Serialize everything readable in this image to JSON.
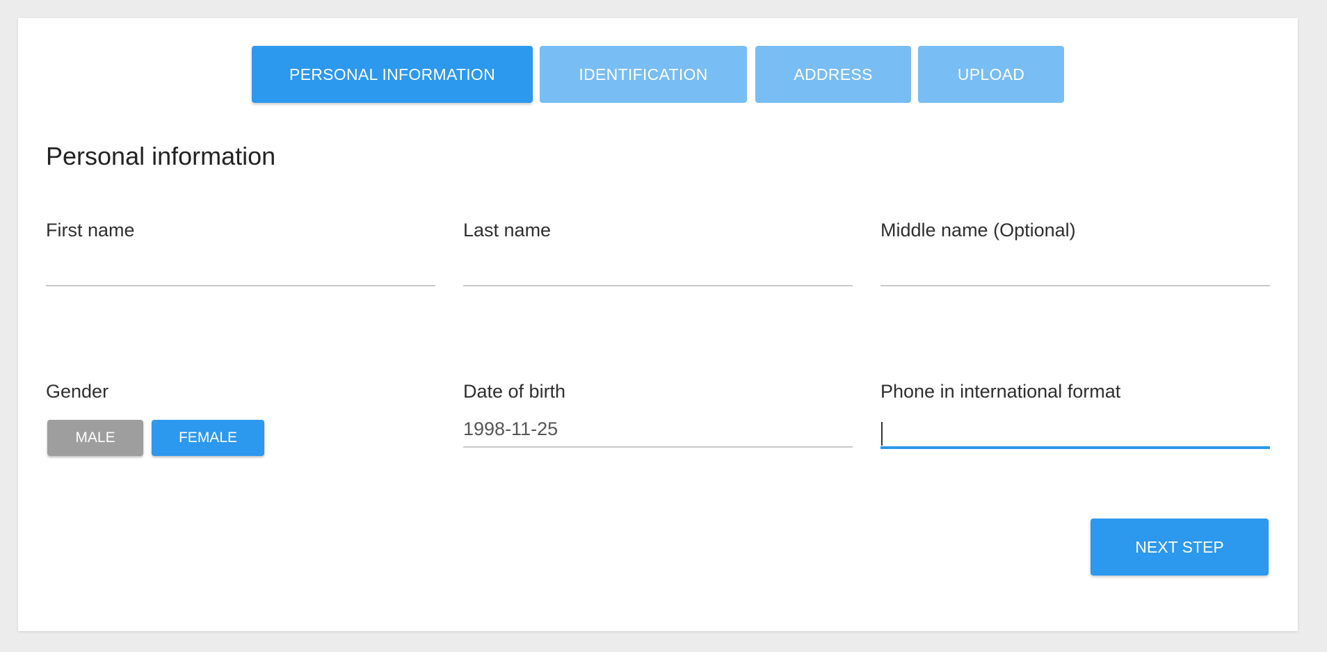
{
  "stepper": {
    "steps": [
      {
        "label": "PERSONAL INFORMATION",
        "active": true
      },
      {
        "label": "IDENTIFICATION",
        "active": false
      },
      {
        "label": "ADDRESS",
        "active": false
      },
      {
        "label": "UPLOAD",
        "active": false
      }
    ]
  },
  "form": {
    "title": "Personal information",
    "first_name": {
      "label": "First name",
      "value": "",
      "placeholder": ""
    },
    "last_name": {
      "label": "Last name",
      "value": "",
      "placeholder": ""
    },
    "middle_name": {
      "label": "Middle name (Optional)",
      "value": "",
      "placeholder": ""
    },
    "gender": {
      "label": "Gender",
      "options": [
        "MALE",
        "FEMALE"
      ],
      "selected": "FEMALE"
    },
    "date_of_birth": {
      "label": "Date of birth",
      "value": "1998-11-25"
    },
    "phone": {
      "label": "Phone in international format",
      "value": "",
      "focused": true
    },
    "next_button_label": "NEXT STEP"
  },
  "colors": {
    "primary": "#2c98ee",
    "primary_light": "#78bdf3",
    "unselected_gray": "#9e9e9e",
    "page_background": "#ececec"
  }
}
